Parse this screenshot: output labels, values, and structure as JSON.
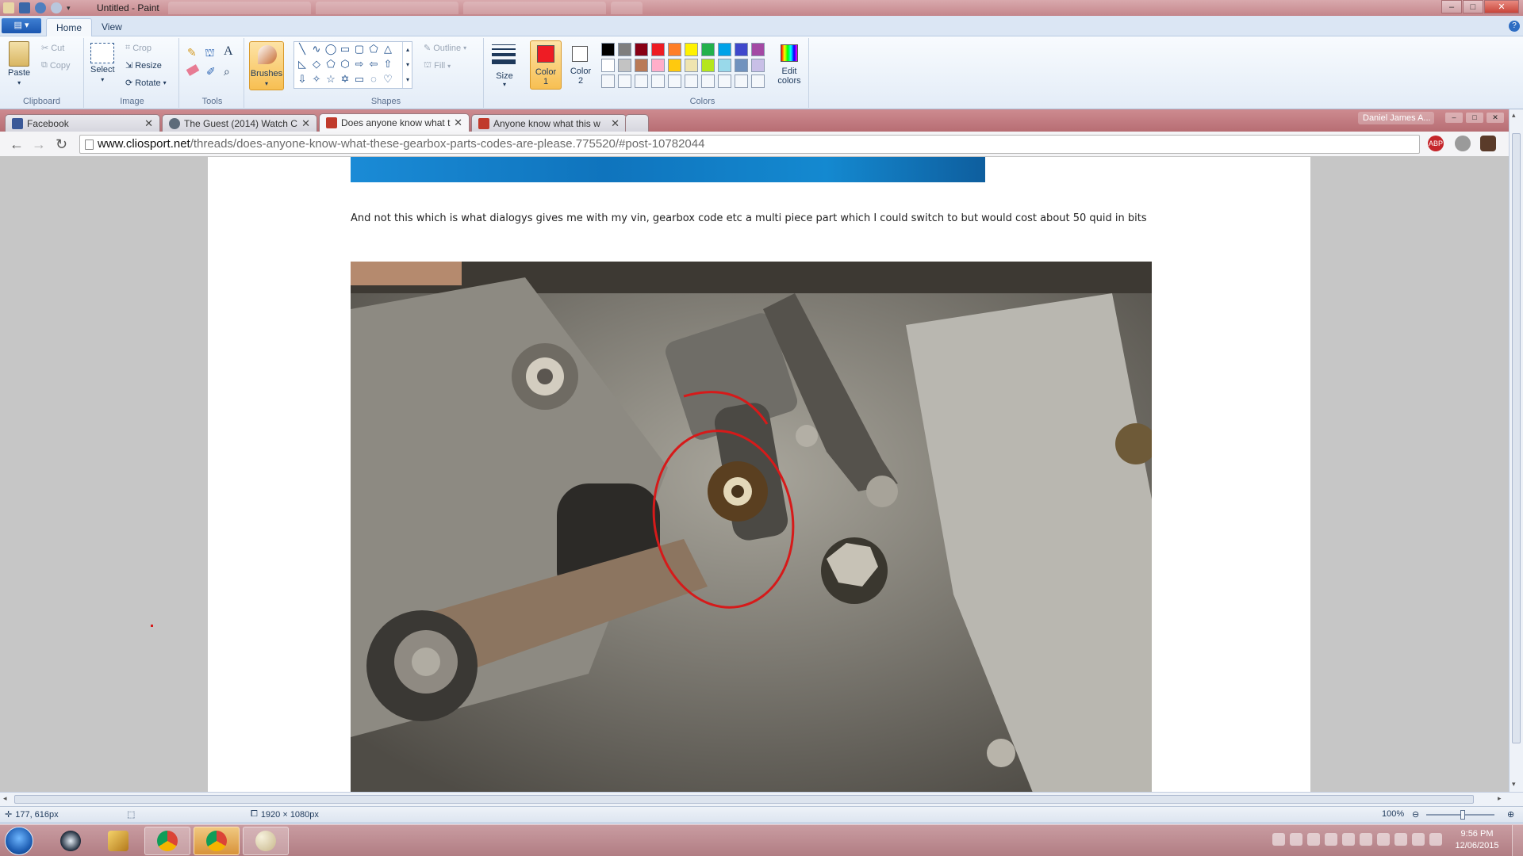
{
  "paint": {
    "window_title": "Untitled - Paint",
    "menu_button_glyph": "▤ ▾",
    "ribbon_tabs": [
      "Home",
      "View"
    ],
    "help_glyph": "?",
    "window_controls": {
      "minimize": "–",
      "maximize": "□",
      "close": "✕"
    },
    "groups": {
      "clipboard": {
        "label": "Clipboard",
        "paste": "Paste",
        "cut": "Cut",
        "copy": "Copy"
      },
      "image": {
        "label": "Image",
        "select": "Select",
        "crop": "Crop",
        "resize": "Resize",
        "rotate": "Rotate"
      },
      "tools": {
        "label": "Tools"
      },
      "brushes": {
        "label": "Brushes"
      },
      "shapes": {
        "label": "Shapes",
        "outline": "Outline",
        "fill": "Fill"
      },
      "size": {
        "label": "Size"
      },
      "color1": {
        "label": "Color",
        "sub": "1",
        "value": "#ee1c24"
      },
      "color2": {
        "label": "Color",
        "sub": "2",
        "value": "#ffffff"
      },
      "colors": {
        "label": "Colors",
        "edit": "Edit",
        "edit2": "colors"
      }
    },
    "palette_row1": [
      "#000000",
      "#7f7f7f",
      "#880015",
      "#ed1c24",
      "#ff7f27",
      "#fff200",
      "#22b14c",
      "#00a2e8",
      "#3f48cc",
      "#a349a4"
    ],
    "palette_row2": [
      "#ffffff",
      "#c3c3c3",
      "#b97a57",
      "#ffaec9",
      "#ffc90e",
      "#efe4b0",
      "#b5e61d",
      "#99d9ea",
      "#7092be",
      "#c8bfe7"
    ],
    "status": {
      "cursor_pos": "177, 616px",
      "image_size": "1920 × 1080px",
      "zoom": "100%"
    }
  },
  "browser": {
    "tabs": [
      {
        "title": "Facebook",
        "favicon_color": "#3b5998"
      },
      {
        "title": "The Guest (2014) Watch C",
        "favicon_color": "#5d6b7a"
      },
      {
        "title": "Does anyone know what t",
        "favicon_color": "#c03a2b"
      },
      {
        "title": "Anyone know what this w",
        "favicon_color": "#c03a2b"
      }
    ],
    "active_tab": 2,
    "user": "Daniel James A...",
    "url_host": "www.cliosport.net",
    "url_path": "/threads/does-anyone-know-what-these-gearbox-parts-codes-are-please.775520/#post-10782044",
    "extensions": [
      "ABP",
      "",
      ""
    ]
  },
  "post": {
    "text": "And not this which is what dialogys gives me with my vin, gearbox code etc a multi piece part which I could switch to but would cost about 50 quid in bits"
  },
  "taskbar": {
    "clock_time": "9:56 PM",
    "clock_date": "12/06/2015"
  }
}
